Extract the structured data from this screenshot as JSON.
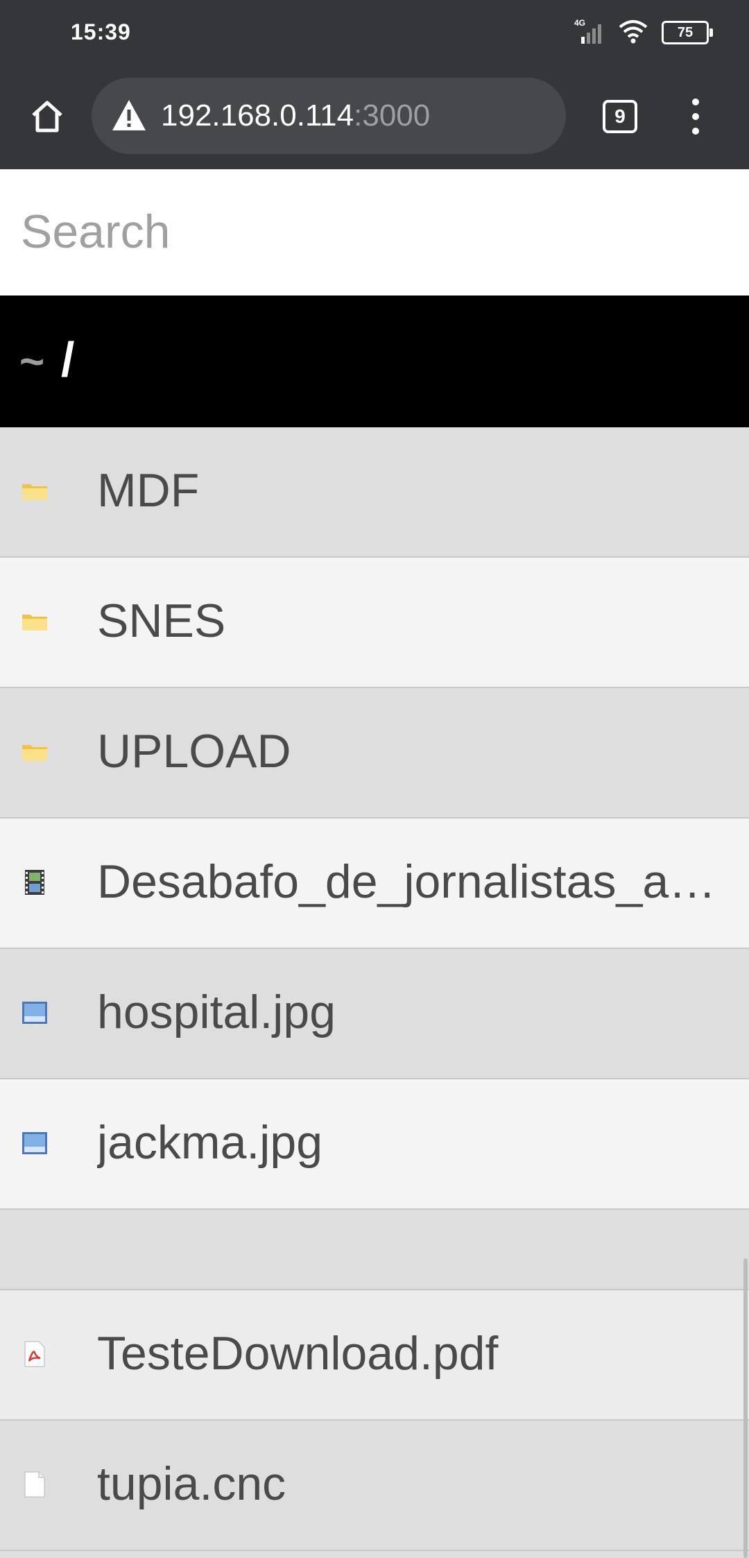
{
  "status_bar": {
    "time": "15:39",
    "network": "4G",
    "battery": "75"
  },
  "toolbar": {
    "url_host": "192.168.0.114",
    "url_port": ":3000",
    "tab_count": "9"
  },
  "search": {
    "placeholder": "Search",
    "value": ""
  },
  "breadcrumb": {
    "home": "~",
    "root": "/"
  },
  "files": [
    {
      "name": "MDF",
      "icon": "folder-icon"
    },
    {
      "name": "SNES",
      "icon": "folder-icon"
    },
    {
      "name": "UPLOAD",
      "icon": "folder-icon"
    },
    {
      "name": "Desabafo_de_jornalistas_a…",
      "icon": "video-icon"
    },
    {
      "name": "hospital.jpg",
      "icon": "image-icon"
    },
    {
      "name": "jackma.jpg",
      "icon": "image-icon"
    },
    {
      "name": "TesteDownload.pdf",
      "icon": "pdf-icon"
    },
    {
      "name": "tupia.cnc",
      "icon": "file-icon"
    }
  ],
  "colors": {
    "chrome_bg": "#35363a",
    "breadcrumb_bg": "#000000",
    "row_odd": "#dedede",
    "row_even": "#f4f4f4"
  }
}
